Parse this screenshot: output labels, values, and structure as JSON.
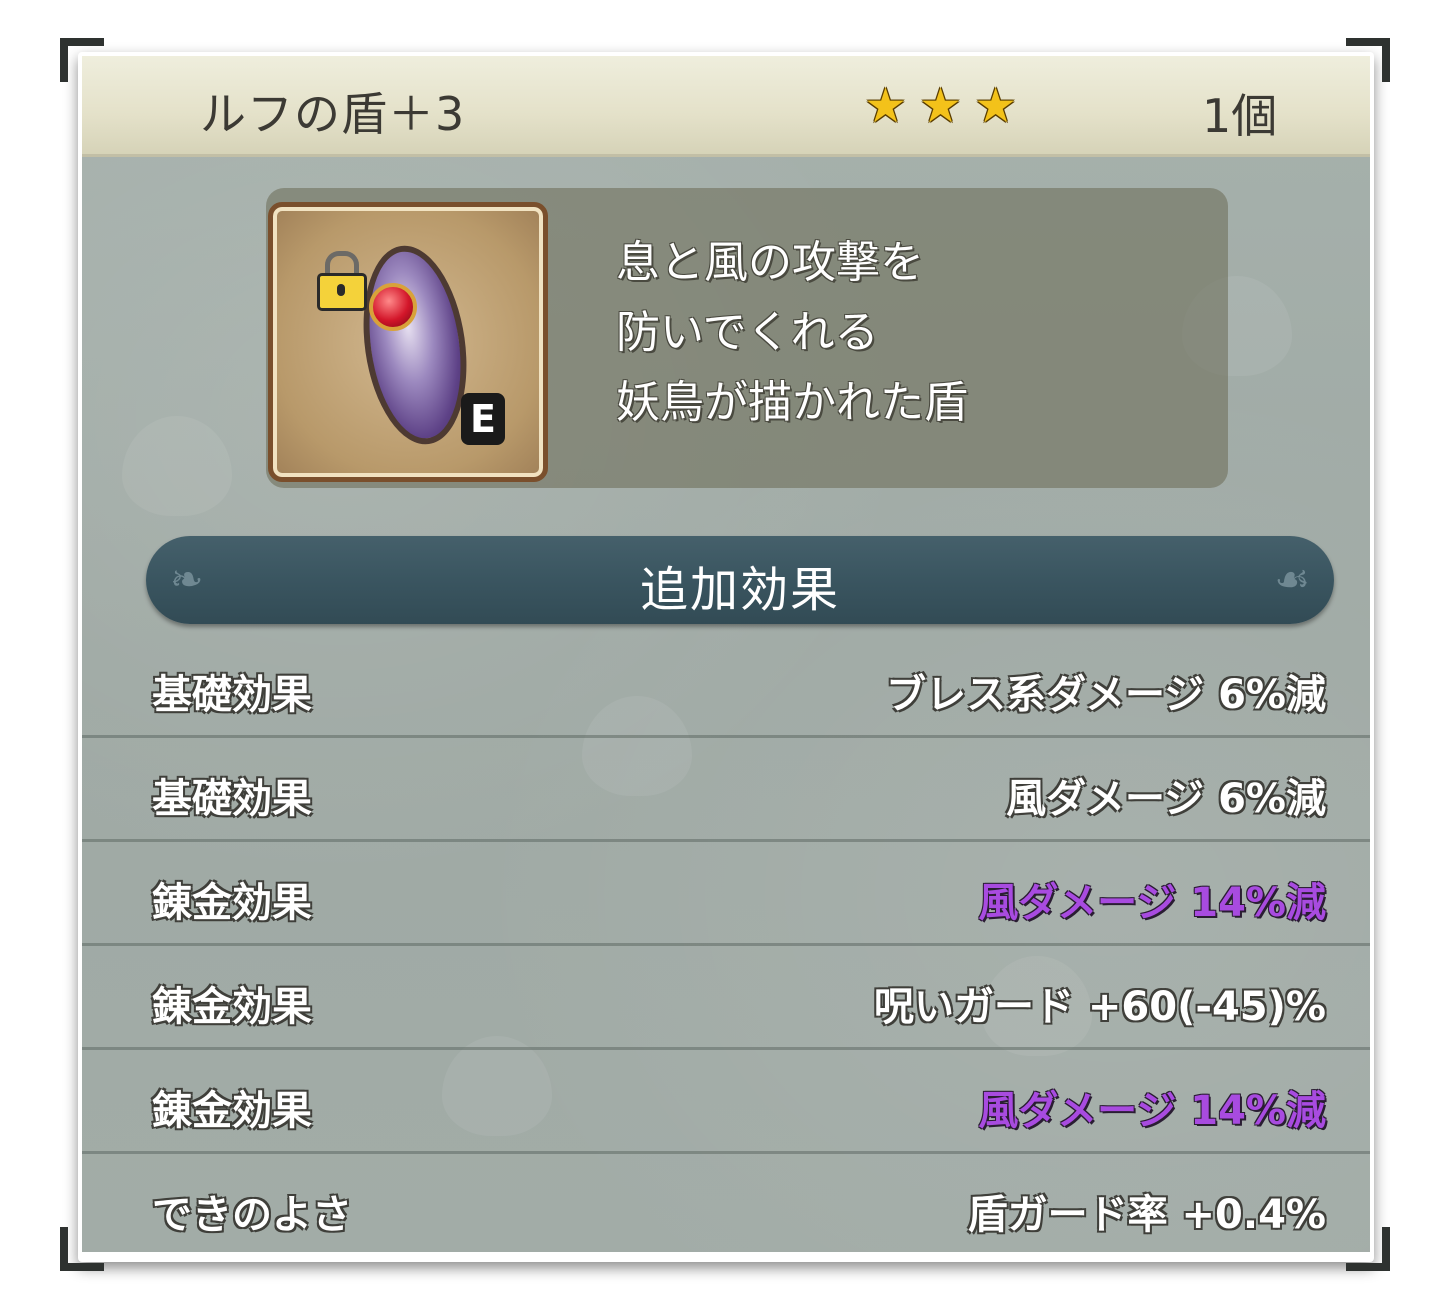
{
  "header": {
    "item_name": "ルフの盾＋3",
    "stars": [
      "★",
      "★",
      "★"
    ],
    "count": "1個"
  },
  "item": {
    "icon": "shield-icon",
    "lock_icon": "lock-icon",
    "equipped_badge": "E",
    "description": "息と風の攻撃を\n防いでくれる\n妖鳥が描かれた盾"
  },
  "section": {
    "title": "追加効果"
  },
  "effects": [
    {
      "label": "基礎効果",
      "value": "ブレス系ダメージ 6%減",
      "highlight": false
    },
    {
      "label": "基礎効果",
      "value": "風ダメージ 6%減",
      "highlight": false
    },
    {
      "label": "錬金効果",
      "value": "風ダメージ 14%減",
      "highlight": true
    },
    {
      "label": "錬金効果",
      "value": "呪いガード +60(-45)%",
      "highlight": false
    },
    {
      "label": "錬金効果",
      "value": "風ダメージ 14%減",
      "highlight": true
    },
    {
      "label": "できのよさ",
      "value": "盾ガード率 +0.4%",
      "highlight": false
    }
  ],
  "colors": {
    "highlight": "#a84be0",
    "star": "#f3c21a",
    "section_bar": "#3a5560"
  }
}
